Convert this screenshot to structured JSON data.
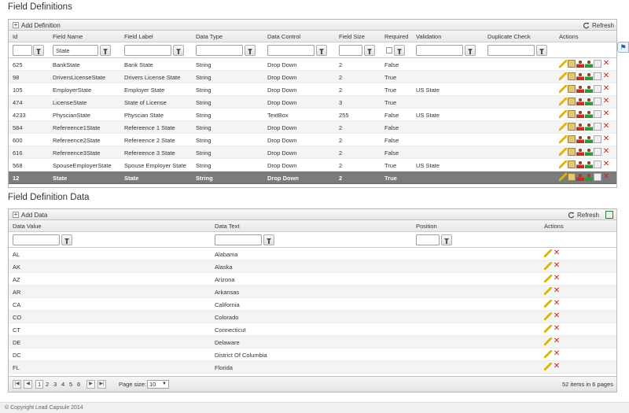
{
  "definitions": {
    "title": "Field Definitions",
    "add_label": "Add Definition",
    "refresh_label": "Refresh",
    "headers": [
      "Id",
      "Field Name",
      "Field Label",
      "Data Type",
      "Data Control",
      "Field Size",
      "Required",
      "Validation",
      "Duplicate Check",
      "Actions"
    ],
    "filter_field_name": "State",
    "rows": [
      {
        "id": "625",
        "name": "BankState",
        "label": "Bank State",
        "type": "String",
        "control": "Drop Down",
        "size": "2",
        "required": "False",
        "validation": ""
      },
      {
        "id": "98",
        "name": "DriversLicenseState",
        "label": "Drivers License State",
        "type": "String",
        "control": "Drop Down",
        "size": "2",
        "required": "True",
        "validation": ""
      },
      {
        "id": "105",
        "name": "EmployerState",
        "label": "Employer State",
        "type": "String",
        "control": "Drop Down",
        "size": "2",
        "required": "True",
        "validation": "US State"
      },
      {
        "id": "474",
        "name": "LicenseState",
        "label": "State of License",
        "type": "String",
        "control": "Drop Down",
        "size": "3",
        "required": "True",
        "validation": ""
      },
      {
        "id": "4233",
        "name": "PhyscianState",
        "label": "Physcian State",
        "type": "String",
        "control": "TextBox",
        "size": "255",
        "required": "False",
        "validation": "US State"
      },
      {
        "id": "584",
        "name": "Refereence1State",
        "label": "Refereence 1 State",
        "type": "String",
        "control": "Drop Down",
        "size": "2",
        "required": "False",
        "validation": ""
      },
      {
        "id": "600",
        "name": "Refereence2State",
        "label": "Refereence 2 State",
        "type": "String",
        "control": "Drop Down",
        "size": "2",
        "required": "False",
        "validation": ""
      },
      {
        "id": "616",
        "name": "Refereence3State",
        "label": "Refereence 3 State",
        "type": "String",
        "control": "Drop Down",
        "size": "2",
        "required": "False",
        "validation": ""
      },
      {
        "id": "568",
        "name": "SpouseEmployerState",
        "label": "Spouse Employer State",
        "type": "String",
        "control": "Drop Down",
        "size": "2",
        "required": "True",
        "validation": "US State"
      },
      {
        "id": "12",
        "name": "State",
        "label": "State",
        "type": "String",
        "control": "Drop Down",
        "size": "2",
        "required": "True",
        "validation": ""
      }
    ],
    "selected_row_index": 9
  },
  "data": {
    "title": "Field Definition Data",
    "add_label": "Add Data",
    "refresh_label": "Refresh",
    "headers": [
      "Data Value",
      "Data Text",
      "Position",
      "Actions"
    ],
    "rows": [
      {
        "value": "AL",
        "text": "Alabama"
      },
      {
        "value": "AK",
        "text": "Alaska"
      },
      {
        "value": "AZ",
        "text": "Arizona"
      },
      {
        "value": "AR",
        "text": "Arkansas"
      },
      {
        "value": "CA",
        "text": "California"
      },
      {
        "value": "CO",
        "text": "Colorado"
      },
      {
        "value": "CT",
        "text": "Connecticut"
      },
      {
        "value": "DE",
        "text": "Delaware"
      },
      {
        "value": "DC",
        "text": "District Of Columbia"
      },
      {
        "value": "FL",
        "text": "Florida"
      }
    ],
    "pager": {
      "pages": [
        "1",
        "2",
        "3",
        "4",
        "5",
        "6"
      ],
      "current_page": "1",
      "page_size_label": "Page size:",
      "page_size": "10",
      "summary": "52 items in 6 pages"
    }
  },
  "footer": "© Copyright Lead Capsule 2014",
  "icons": [
    "plus-icon",
    "refresh-icon",
    "filter-icon",
    "pencil-icon",
    "folder-icon",
    "person-red-icon",
    "person-green-icon",
    "card-icon",
    "delete-icon",
    "export-icon"
  ]
}
